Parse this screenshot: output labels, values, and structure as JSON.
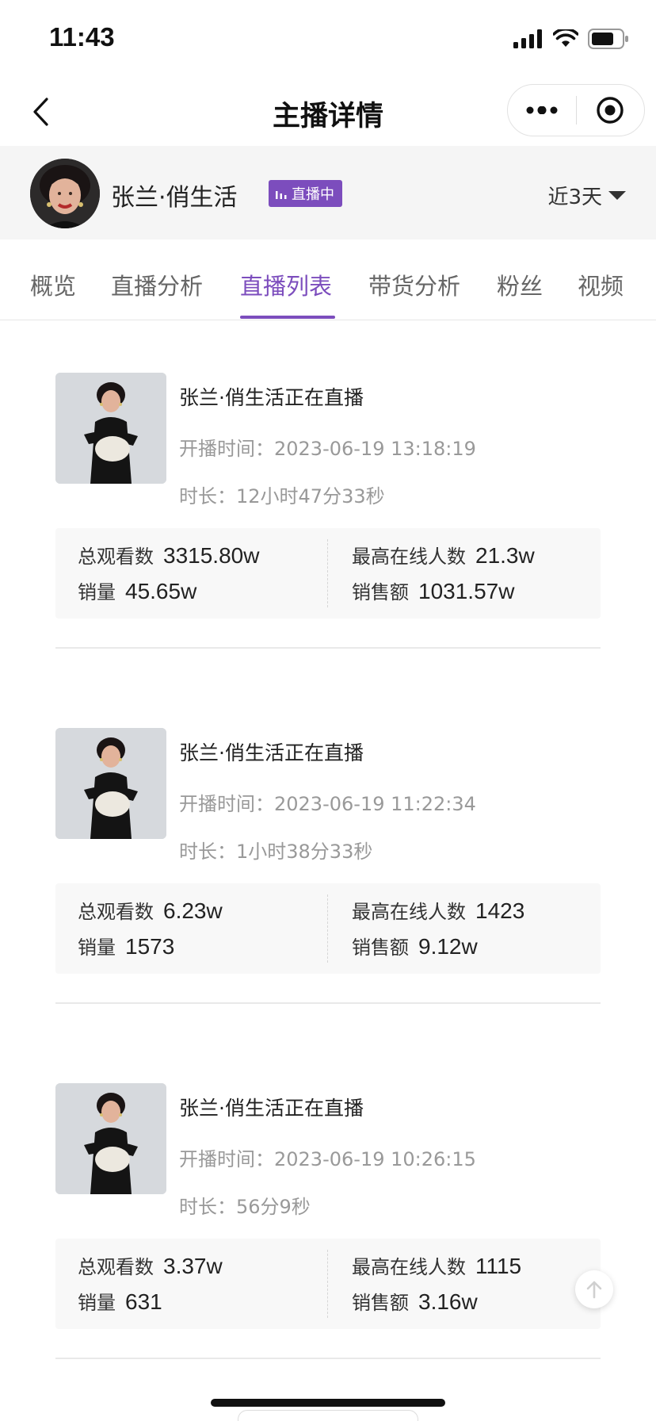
{
  "status_bar": {
    "time": "11:43"
  },
  "nav": {
    "title": "主播详情"
  },
  "anchor": {
    "name": "张兰·俏生活",
    "live_badge": "直播中",
    "period": "近3天"
  },
  "tabs": [
    {
      "label": "概览"
    },
    {
      "label": "直播分析"
    },
    {
      "label": "直播列表"
    },
    {
      "label": "带货分析"
    },
    {
      "label": "粉丝"
    },
    {
      "label": "视频"
    }
  ],
  "active_tab": "直播列表",
  "live_list": [
    {
      "title": "张兰·俏生活正在直播",
      "start_label": "开播时间：",
      "start_time": "2023-06-19 13:18:19",
      "duration_label": "时长：",
      "duration": "12小时47分33秒",
      "total_views_label": "总观看数",
      "total_views": "3315.80w",
      "peak_online_label": "最高在线人数",
      "peak_online": "21.3w",
      "sales_volume_label": "销量",
      "sales_volume": "45.65w",
      "sales_amount_label": "销售额",
      "sales_amount": "1031.57w"
    },
    {
      "title": "张兰·俏生活正在直播",
      "start_label": "开播时间：",
      "start_time": "2023-06-19 11:22:34",
      "duration_label": "时长：",
      "duration": "1小时38分33秒",
      "total_views_label": "总观看数",
      "total_views": "6.23w",
      "peak_online_label": "最高在线人数",
      "peak_online": "1423",
      "sales_volume_label": "销量",
      "sales_volume": "1573",
      "sales_amount_label": "销售额",
      "sales_amount": "9.12w"
    },
    {
      "title": "张兰·俏生活正在直播",
      "start_label": "开播时间：",
      "start_time": "2023-06-19 10:26:15",
      "duration_label": "时长：",
      "duration": "56分9秒",
      "total_views_label": "总观看数",
      "total_views": "3.37w",
      "peak_online_label": "最高在线人数",
      "peak_online": "1115",
      "sales_volume_label": "销量",
      "sales_volume": "631",
      "sales_amount_label": "销售额",
      "sales_amount": "3.16w"
    }
  ],
  "icons": {
    "signal": "cellular-signal-icon",
    "wifi": "wifi-icon",
    "battery": "battery-icon",
    "back": "chevron-left-icon",
    "more": "more-dots-icon",
    "target": "target-icon",
    "live": "bar-chart-icon",
    "dropdown": "caret-down-icon",
    "scroll_top": "arrow-up-icon"
  },
  "colors": {
    "accent": "#7c4dbd",
    "header_bg": "#f5f5f5",
    "stats_bg": "#f8f8f8"
  }
}
